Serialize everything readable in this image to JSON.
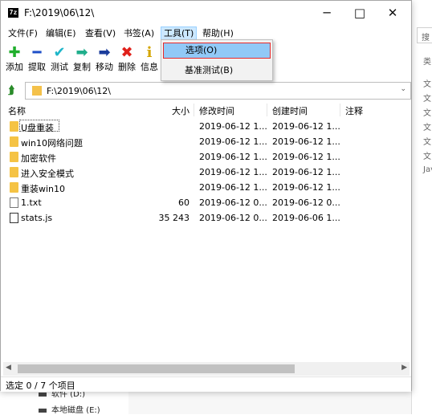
{
  "window": {
    "title": "F:\\2019\\06\\12\\",
    "app_icon_text": "7z",
    "controls": {
      "minimize": "─",
      "maximize": "□",
      "close": "✕"
    }
  },
  "menubar": {
    "items": [
      "文件(F)",
      "编辑(E)",
      "查看(V)",
      "书签(A)",
      "工具(T)",
      "帮助(H)"
    ]
  },
  "tools_menu": {
    "items": [
      "选项(O)",
      "基准测试(B)"
    ]
  },
  "toolbar": {
    "buttons": [
      {
        "label": "添加",
        "icon": "plus-icon",
        "glyph": "✚",
        "color": "#1fae2c"
      },
      {
        "label": "提取",
        "icon": "minus-icon",
        "glyph": "━",
        "color": "#2050c8"
      },
      {
        "label": "测试",
        "icon": "check-icon",
        "glyph": "✔",
        "color": "#1fb6c9"
      },
      {
        "label": "复制",
        "icon": "copy-arrow-icon",
        "glyph": "➡",
        "color": "#1fae8c"
      },
      {
        "label": "移动",
        "icon": "move-arrow-icon",
        "glyph": "➡",
        "color": "#1b3d9c"
      },
      {
        "label": "删除",
        "icon": "delete-icon",
        "glyph": "✖",
        "color": "#e0201a"
      },
      {
        "label": "信息",
        "icon": "info-icon",
        "glyph": "i",
        "color": "#d4a500"
      }
    ]
  },
  "address": {
    "path": "F:\\2019\\06\\12\\"
  },
  "list": {
    "columns": [
      "名称",
      "大小",
      "修改时间",
      "创建时间",
      "注释"
    ],
    "rows": [
      {
        "name": "U盘重装",
        "size": "",
        "modified": "2019-06-12 1...",
        "created": "2019-06-12 1...",
        "type": "folder"
      },
      {
        "name": "win10网络问题",
        "size": "",
        "modified": "2019-06-12 1...",
        "created": "2019-06-12 1...",
        "type": "folder"
      },
      {
        "name": "加密软件",
        "size": "",
        "modified": "2019-06-12 1...",
        "created": "2019-06-12 1...",
        "type": "folder"
      },
      {
        "name": "进入安全模式",
        "size": "",
        "modified": "2019-06-12 1...",
        "created": "2019-06-12 1...",
        "type": "folder"
      },
      {
        "name": "重装win10",
        "size": "",
        "modified": "2019-06-12 1...",
        "created": "2019-06-12 1...",
        "type": "folder"
      },
      {
        "name": "1.txt",
        "size": "60",
        "modified": "2019-06-12 0...",
        "created": "2019-06-12 0...",
        "type": "txt"
      },
      {
        "name": "stats.js",
        "size": "35 243",
        "modified": "2019-06-12 0...",
        "created": "2019-06-06 1...",
        "type": "js"
      }
    ]
  },
  "status": {
    "text": "选定 0 / 7 个项目"
  },
  "background": {
    "right_search": "搜",
    "right_labels": [
      "类",
      "文",
      "文",
      "文",
      "文",
      "文",
      "文",
      "Jav"
    ],
    "drives": [
      "软件 (D:)",
      "本地磁盘 (E:)"
    ]
  }
}
